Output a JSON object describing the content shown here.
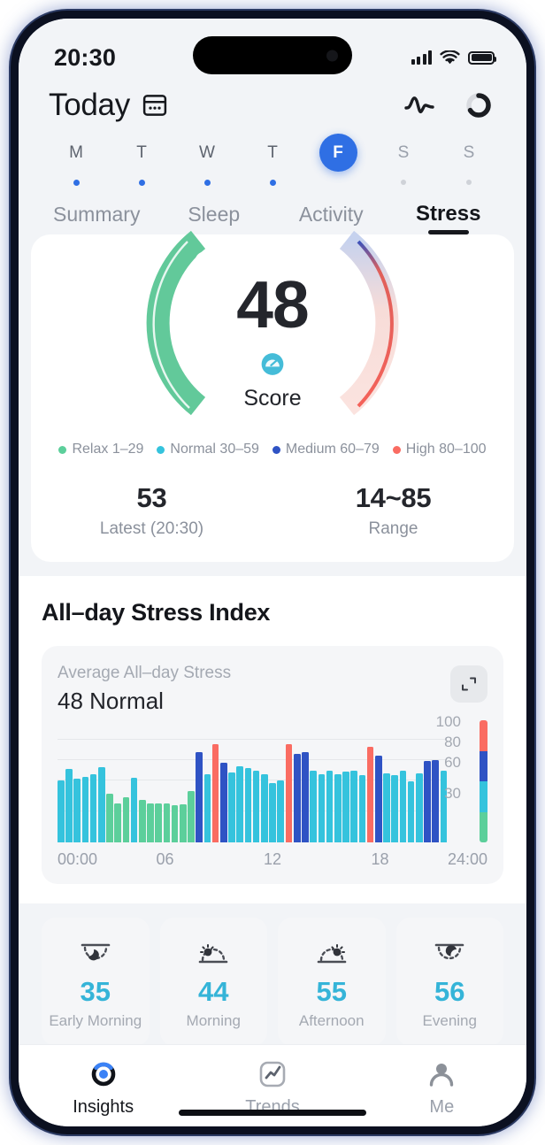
{
  "status_bar": {
    "time": "20:30",
    "signal_icon": "cellular-signal-icon",
    "wifi_icon": "wifi-icon",
    "battery_icon": "battery-icon"
  },
  "header": {
    "title": "Today",
    "calendar_icon": "calendar-icon",
    "pulse_icon": "pulse-icon",
    "sync_ring_icon": "sync-ring-icon"
  },
  "week": {
    "days": [
      {
        "label": "M",
        "state": "past"
      },
      {
        "label": "T",
        "state": "past"
      },
      {
        "label": "W",
        "state": "past"
      },
      {
        "label": "T",
        "state": "past"
      },
      {
        "label": "F",
        "state": "active"
      },
      {
        "label": "S",
        "state": "future"
      },
      {
        "label": "S",
        "state": "future"
      }
    ]
  },
  "tabs": [
    {
      "label": "Summary",
      "active": false
    },
    {
      "label": "Sleep",
      "active": false
    },
    {
      "label": "Activity",
      "active": false
    },
    {
      "label": "Stress",
      "active": true
    }
  ],
  "gauge": {
    "value": "48",
    "score_label": "Score",
    "score_icon": "score-gauge-icon",
    "marker_icon": "gauge-marker-icon",
    "active_color": "#62c99a",
    "inactive_colors": [
      "#c6d2ee",
      "#f6d7d4"
    ]
  },
  "legend": [
    {
      "label": "Relax 1–29",
      "color": "#5ccf9b"
    },
    {
      "label": "Normal 30–59",
      "color": "#35c3dd"
    },
    {
      "label": "Medium 60–79",
      "color": "#2f53c4"
    },
    {
      "label": "High 80–100",
      "color": "#fa6c62"
    }
  ],
  "stats": [
    {
      "value": "53",
      "label": "Latest (20:30)"
    },
    {
      "value": "14~85",
      "label": "Range"
    }
  ],
  "allday": {
    "title": "All–day Stress Index",
    "average_caption": "Average All–day Stress",
    "average_value": "48 Normal",
    "expand_icon": "expand-icon"
  },
  "chart_data": {
    "type": "bar",
    "title": "All–day Stress Index",
    "xlabel": "",
    "ylabel": "",
    "ylim": [
      0,
      110
    ],
    "grid": true,
    "y_ticks": [
      30,
      60,
      80,
      100
    ],
    "x_ticks": [
      "00:00",
      "06",
      "12",
      "18",
      "24:00"
    ],
    "x_tick_positions": [
      0,
      25,
      50,
      75,
      100
    ],
    "color_scale": [
      {
        "range": "80–100",
        "color": "#fa6c62"
      },
      {
        "range": "60–79",
        "color": "#2f53c4"
      },
      {
        "range": "30–59",
        "color": "#35c3dd"
      },
      {
        "range": "1–29",
        "color": "#5ccf9b"
      }
    ],
    "values": [
      60,
      71,
      62,
      64,
      66,
      73,
      47,
      38,
      44,
      63,
      41,
      38,
      38,
      38,
      36,
      37,
      50,
      88,
      66,
      95,
      77,
      68,
      74,
      72,
      70,
      66,
      58,
      60,
      95,
      86,
      88,
      70,
      66,
      70,
      66,
      69,
      70,
      65,
      93,
      84,
      67,
      65,
      70,
      59,
      67,
      79,
      80,
      70
    ],
    "bar_colors": [
      "#35c3dd",
      "#35c3dd",
      "#35c3dd",
      "#35c3dd",
      "#35c3dd",
      "#35c3dd",
      "#5ccf9b",
      "#5ccf9b",
      "#5ccf9b",
      "#35c3dd",
      "#5ccf9b",
      "#5ccf9b",
      "#5ccf9b",
      "#5ccf9b",
      "#5ccf9b",
      "#5ccf9b",
      "#5ccf9b",
      "#2f53c4",
      "#35c3dd",
      "#fa6c62",
      "#2f53c4",
      "#35c3dd",
      "#35c3dd",
      "#35c3dd",
      "#35c3dd",
      "#35c3dd",
      "#35c3dd",
      "#35c3dd",
      "#fa6c62",
      "#2f53c4",
      "#2f53c4",
      "#35c3dd",
      "#35c3dd",
      "#35c3dd",
      "#35c3dd",
      "#35c3dd",
      "#35c3dd",
      "#35c3dd",
      "#fa6c62",
      "#2f53c4",
      "#35c3dd",
      "#35c3dd",
      "#35c3dd",
      "#35c3dd",
      "#35c3dd",
      "#2f53c4",
      "#2f53c4",
      "#35c3dd"
    ]
  },
  "periods": [
    {
      "value": "35",
      "label": "Early Morning",
      "icon": "moon-dawn-icon"
    },
    {
      "value": "44",
      "label": "Morning",
      "icon": "sun-rise-icon"
    },
    {
      "value": "55",
      "label": "Afternoon",
      "icon": "sun-set-icon"
    },
    {
      "value": "56",
      "label": "Evening",
      "icon": "moon-dusk-icon"
    }
  ],
  "bottom_nav": [
    {
      "label": "Insights",
      "icon": "insights-ring-icon",
      "active": true
    },
    {
      "label": "Trends",
      "icon": "trends-chart-icon",
      "active": false
    },
    {
      "label": "Me",
      "icon": "person-icon",
      "active": false
    }
  ]
}
